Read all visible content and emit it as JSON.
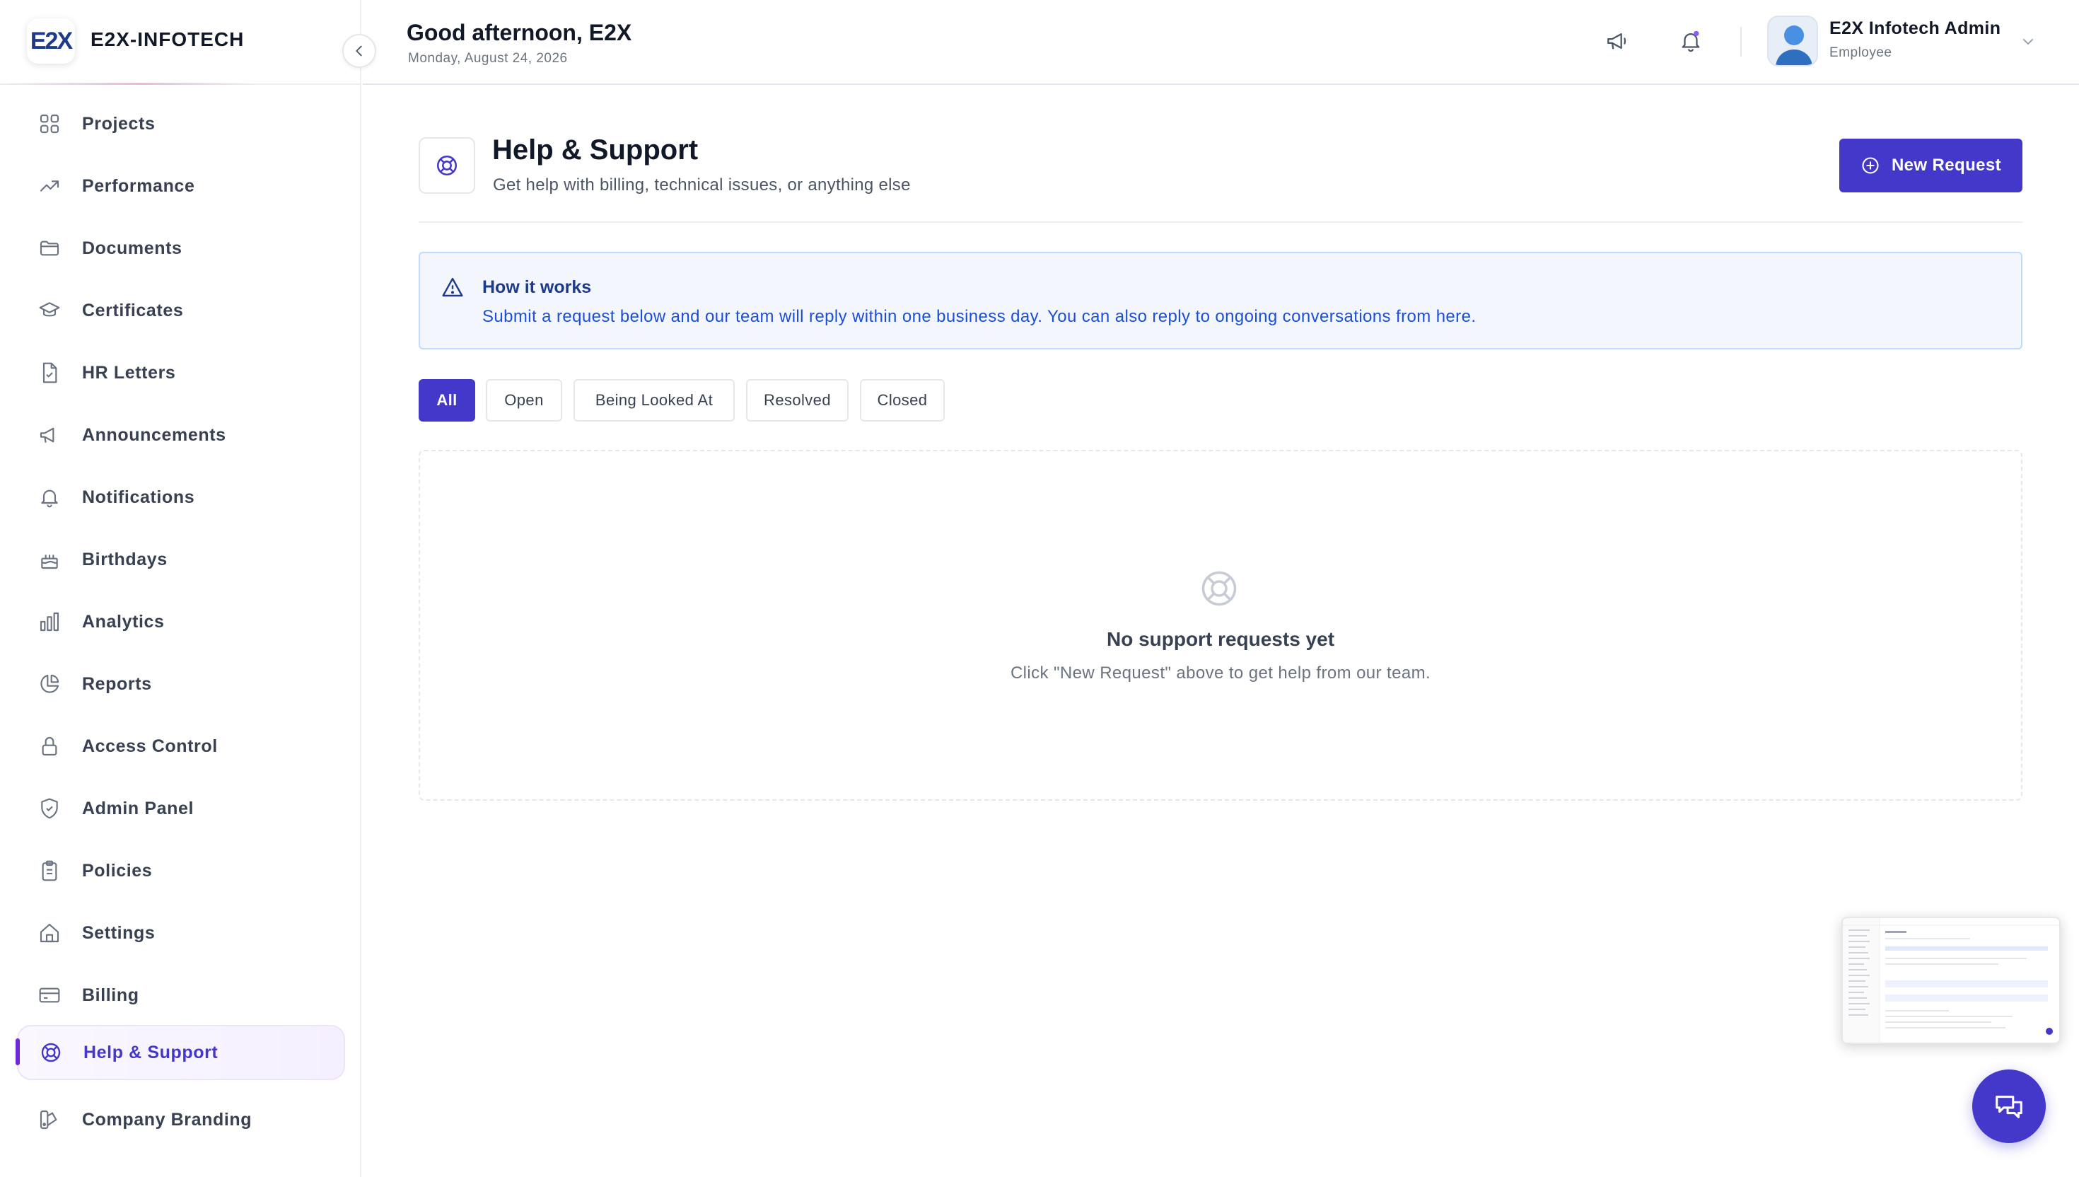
{
  "brand": {
    "logo_text": "E2X",
    "name": "E2X-INFOTECH"
  },
  "sidebar": {
    "items": [
      {
        "label": "Projects",
        "icon": "grid-icon"
      },
      {
        "label": "Performance",
        "icon": "trending-up-icon"
      },
      {
        "label": "Documents",
        "icon": "folder-icon"
      },
      {
        "label": "Certificates",
        "icon": "graduation-cap-icon"
      },
      {
        "label": "HR Letters",
        "icon": "file-check-icon"
      },
      {
        "label": "Announcements",
        "icon": "megaphone-icon"
      },
      {
        "label": "Notifications",
        "icon": "bell-icon"
      },
      {
        "label": "Birthdays",
        "icon": "cake-icon"
      },
      {
        "label": "Analytics",
        "icon": "bar-chart-icon"
      },
      {
        "label": "Reports",
        "icon": "pie-chart-icon"
      },
      {
        "label": "Access Control",
        "icon": "lock-icon"
      },
      {
        "label": "Admin Panel",
        "icon": "shield-check-icon"
      },
      {
        "label": "Policies",
        "icon": "clipboard-icon"
      },
      {
        "label": "Settings",
        "icon": "home-icon"
      },
      {
        "label": "Billing",
        "icon": "credit-card-icon"
      },
      {
        "label": "Help & Support",
        "icon": "life-buoy-icon",
        "active": true
      },
      {
        "label": "Company Branding",
        "icon": "palette-icon"
      }
    ]
  },
  "header": {
    "greeting": "Good afternoon, E2X",
    "date": "Monday, August 24, 2026",
    "user_name": "E2X Infotech Admin",
    "user_role": "Employee"
  },
  "page": {
    "title": "Help & Support",
    "subtitle": "Get help with billing, technical issues, or anything else",
    "new_request_label": "New Request"
  },
  "info": {
    "title": "How it works",
    "text": "Submit a request below and our team will reply within one business day. You can also reply to ongoing conversations from here."
  },
  "filters": {
    "tabs": [
      "All",
      "Open",
      "Being Looked At",
      "Resolved",
      "Closed"
    ],
    "selected": "All"
  },
  "empty_state": {
    "title": "No support requests yet",
    "text": "Click \"New Request\" above to get help from our team."
  },
  "colors": {
    "accent": "#4338ca",
    "info_bg": "#f3f7fd",
    "info_border": "#bfdbfe",
    "active_nav_bar": "#6d28d9"
  }
}
